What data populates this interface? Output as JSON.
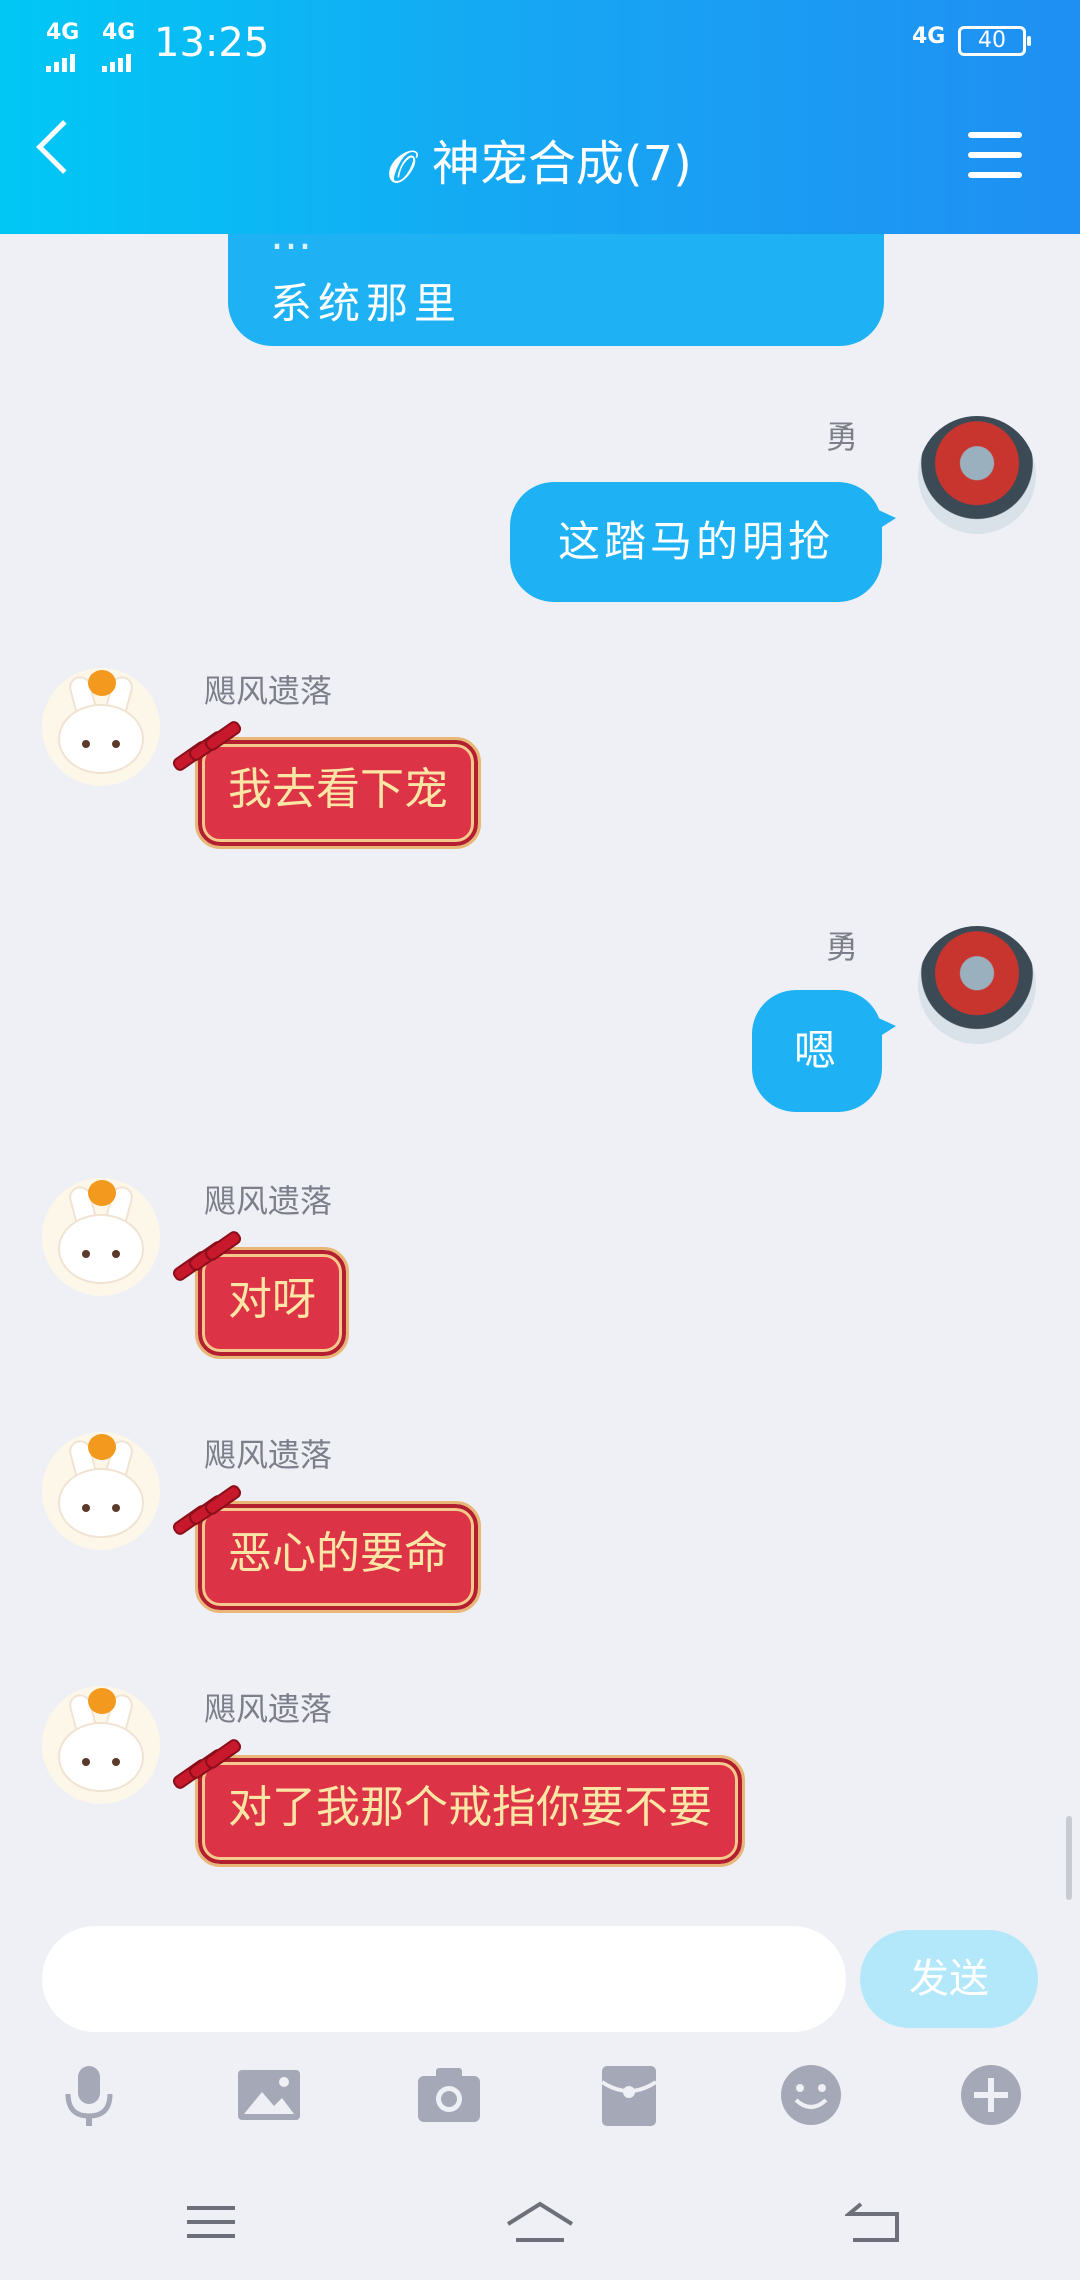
{
  "status_bar": {
    "signal1": "4G",
    "signal2": "4G",
    "time": "13:25",
    "network": "4G",
    "battery": "40"
  },
  "header": {
    "title": "神宠合成(7)",
    "back_icon": "chevron-left-icon",
    "menu_icon": "hamburger-menu-icon",
    "ear_icon": "ear-icon"
  },
  "messages": [
    {
      "side": "right",
      "sender": "",
      "text_line1": "…",
      "text_line2": "系统那里",
      "partial": true
    },
    {
      "side": "right",
      "sender": "勇",
      "text": "这踏马的明抢"
    },
    {
      "side": "left",
      "sender": "飓风遗落",
      "text": "我去看下宠"
    },
    {
      "side": "right",
      "sender": "勇",
      "text": "嗯"
    },
    {
      "side": "left",
      "sender": "飓风遗落",
      "text": "对呀"
    },
    {
      "side": "left",
      "sender": "飓风遗落",
      "text": "恶心的要命"
    },
    {
      "side": "left",
      "sender": "飓风遗落",
      "text": "对了我那个戒指你要不要"
    }
  ],
  "input": {
    "placeholder": "",
    "send_label": "发送"
  },
  "toolbar": [
    "microphone-icon",
    "image-icon",
    "camera-icon",
    "red-packet-icon",
    "emoji-icon",
    "plus-icon"
  ],
  "nav": [
    "recent-apps-icon",
    "home-icon",
    "back-icon"
  ],
  "colors": {
    "accent": "#1eb2f5",
    "red_bubble": "#dd3347",
    "red_text": "#fbe6a6"
  }
}
